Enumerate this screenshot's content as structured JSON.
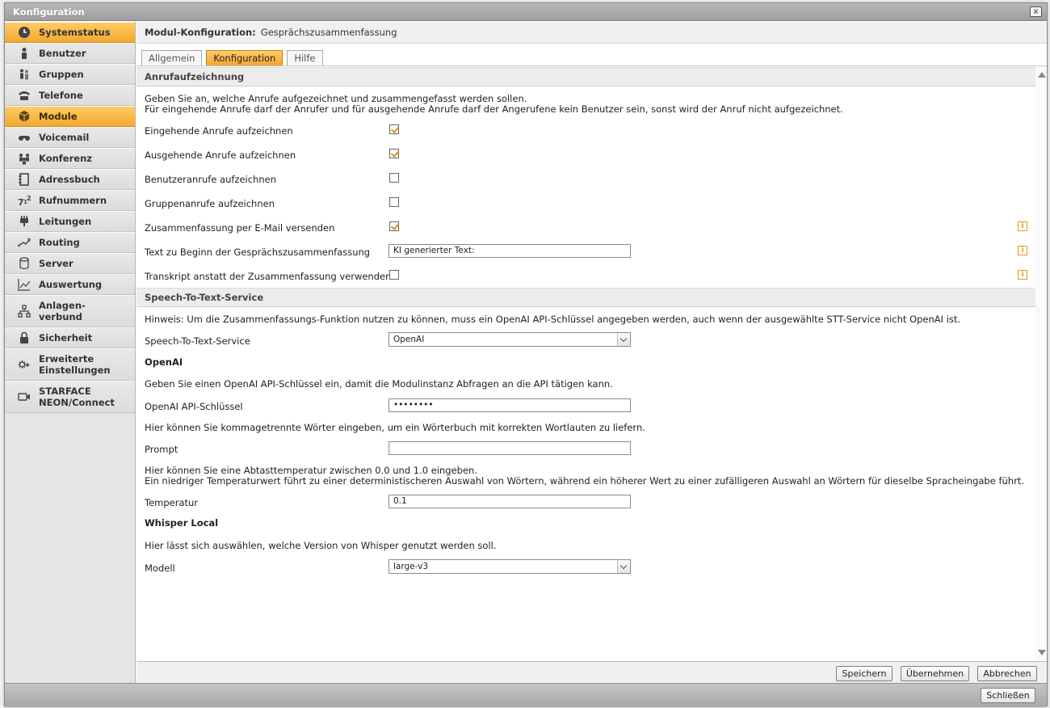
{
  "window": {
    "title": "Konfiguration",
    "close_label": "x"
  },
  "sidebar": {
    "items": [
      {
        "label": "Systemstatus"
      },
      {
        "label": "Benutzer"
      },
      {
        "label": "Gruppen"
      },
      {
        "label": "Telefone"
      },
      {
        "label": "Module"
      },
      {
        "label": "Voicemail"
      },
      {
        "label": "Konferenz"
      },
      {
        "label": "Adressbuch"
      },
      {
        "label": "Rufnummern"
      },
      {
        "label": "Leitungen"
      },
      {
        "label": "Routing"
      },
      {
        "label": "Server"
      },
      {
        "label": "Auswertung"
      },
      {
        "label_line1": "Anlagen-",
        "label_line2": "verbund"
      },
      {
        "label": "Sicherheit"
      },
      {
        "label_line1": "Erweiterte",
        "label_line2": "Einstellungen"
      },
      {
        "label_line1": "STARFACE",
        "label_line2": "NEON/Connect"
      }
    ]
  },
  "module_header": {
    "label": "Modul-Konfiguration:",
    "value": "Gesprächszusammenfassung"
  },
  "tabs": [
    {
      "label": "Allgemein"
    },
    {
      "label": "Konfiguration"
    },
    {
      "label": "Hilfe"
    }
  ],
  "recording": {
    "title": "Anrufaufzeichnung",
    "desc_line1": "Geben Sie an, welche Anrufe aufgezeichnet und zusammengefasst werden sollen.",
    "desc_line2": "Für eingehende Anrufe darf der Anrufer und für ausgehende Anrufe darf der Angerufene kein Benutzer sein, sonst wird der Anruf nicht aufgezeichnet.",
    "incoming_label": "Eingehende Anrufe aufzeichnen",
    "incoming_checked": true,
    "outgoing_label": "Ausgehende Anrufe aufzeichnen",
    "outgoing_checked": true,
    "user_calls_label": "Benutzeranrufe aufzeichnen",
    "user_calls_checked": false,
    "group_calls_label": "Gruppenanrufe aufzeichnen",
    "group_calls_checked": false,
    "email_label": "Zusammenfassung per E-Mail versenden",
    "email_checked": true,
    "text_start_label": "Text zu Beginn der Gesprächszusammenfassung",
    "text_start_value": "KI generierter Text:",
    "transcript_label": "Transkript anstatt der Zusammenfassung verwenden",
    "transcript_checked": false,
    "info_glyph": "i"
  },
  "stt": {
    "title": "Speech-To-Text-Service",
    "hint": "Hinweis: Um die Zusammenfassungs-Funktion nutzen zu können, muss ein OpenAI API-Schlüssel angegeben werden, auch wenn der ausgewählte STT-Service nicht OpenAI ist.",
    "service_label": "Speech-To-Text-Service",
    "service_value": "OpenAI",
    "openai_title": "OpenAI",
    "openai_desc": "Geben Sie einen OpenAI API-Schlüssel ein, damit die Modulinstanz Abfragen an die API tätigen kann.",
    "api_key_label": "OpenAI API-Schlüssel",
    "api_key_value": "••••••••",
    "prompt_desc": "Hier können Sie kommagetrennte Wörter eingeben, um ein Wörterbuch mit korrekten Wortlauten zu liefern.",
    "prompt_label": "Prompt",
    "prompt_value": "",
    "temp_desc_line1": "Hier können Sie eine Abtasttemperatur zwischen 0.0 und 1.0 eingeben.",
    "temp_desc_line2": "Ein niedriger Temperaturwert führt zu einer deterministischeren Auswahl von Wörtern, während ein höherer Wert zu einer zufälligeren Auswahl an Wörtern für dieselbe Spracheingabe führt.",
    "temp_label": "Temperatur",
    "temp_value": "0.1",
    "whisper_title": "Whisper Local",
    "whisper_desc": "Hier lässt sich auswählen, welche Version von Whisper genutzt werden soll.",
    "model_label": "Modell",
    "model_value": "large-v3"
  },
  "footer": {
    "save": "Speichern",
    "apply": "Übernehmen",
    "cancel": "Abbrechen"
  },
  "bottom": {
    "close": "Schließen"
  },
  "colors": {
    "accent": "#f5a52d",
    "check": "#e08a1a"
  }
}
